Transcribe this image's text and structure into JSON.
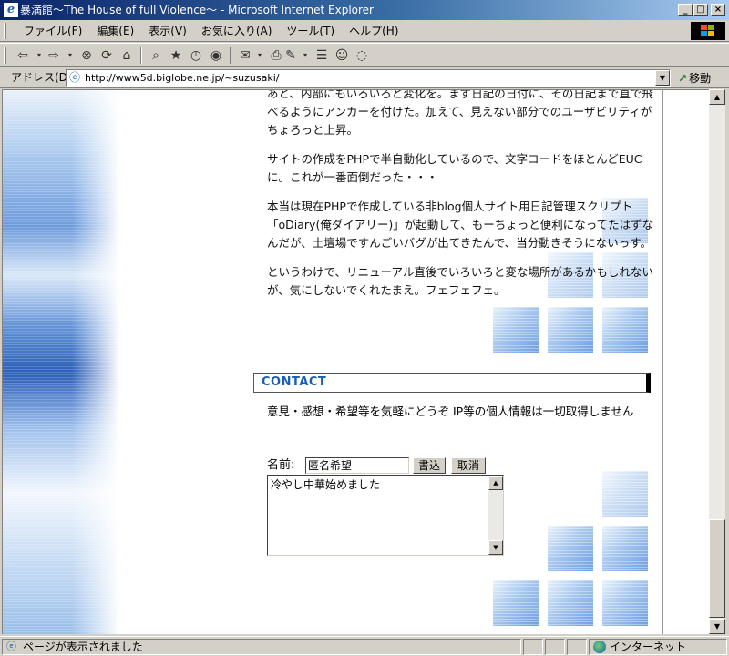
{
  "window": {
    "title": "暴満館～The House of full Violence～ - Microsoft Internet Explorer",
    "app_icon": "ie-logo-icon"
  },
  "menu": {
    "items": [
      "ファイル(F)",
      "編集(E)",
      "表示(V)",
      "お気に入り(A)",
      "ツール(T)",
      "ヘルプ(H)"
    ]
  },
  "toolbar": {
    "icons": [
      "back-icon",
      "forward-icon",
      "stop-icon",
      "refresh-icon",
      "home-icon",
      "search-icon",
      "favorites-icon",
      "history-icon",
      "media-icon",
      "mail-icon",
      "edit-icon",
      "print-icon",
      "discuss-icon",
      "messenger-icon"
    ]
  },
  "address": {
    "label": "アドレス(D)",
    "url": "http://www5d.biglobe.ne.jp/~suzusaki/",
    "go_label": "移動"
  },
  "content": {
    "paragraphs": [
      "あと、内部にもいろいろと変化を。まず日記の日付に、その日記まで直で飛べるようにアンカーを付けた。加えて、見えない部分でのユーザビリティがちょろっと上昇。",
      "サイトの作成をPHPで半自動化しているので、文字コードをほとんどEUCに。これが一番面倒だった・・・",
      "本当は現在PHPで作成している非blog個人サイト用日記管理スクリプト「oDiary(俺ダイアリー)」が起動して、もーちょっと便利になってたはずなんだが、土壇場ですんごいバグが出てきたんで、当分動きそうにないっす。",
      "というわけで、リニューアル直後でいろいろと変な場所があるかもしれないが、気にしないでくれたまえ。フェフェフェ。"
    ],
    "contact_heading": "CONTACT",
    "contact_text": "意見・感想・希望等を気軽にどうぞ IP等の個人情報は一切取得しません",
    "form": {
      "name_label": "名前:",
      "name_value": "匿名希望",
      "submit_label": "書込",
      "cancel_label": "取消",
      "message_value": "冷やし中華始めました"
    }
  },
  "status": {
    "text": "ページが表示されました",
    "zone": "インターネット"
  },
  "colors": {
    "titlebar_start": "#0a246a",
    "titlebar_end": "#a6caf0",
    "heading_blue": "#1a5fb4"
  }
}
